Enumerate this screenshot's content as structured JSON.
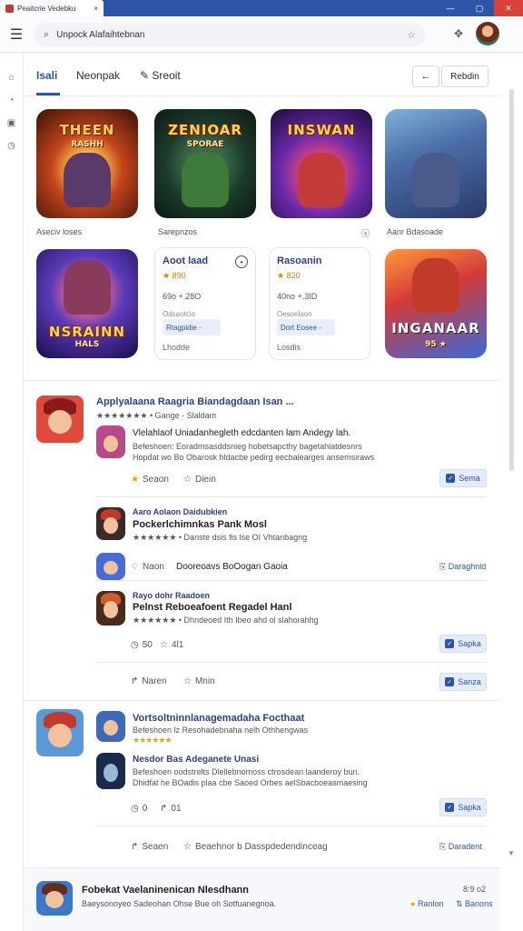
{
  "window": {
    "tab_title": "Peaitcrie Vedebku",
    "tab_close": "×",
    "controls": [
      "—",
      "▢",
      "✕"
    ]
  },
  "toolbar": {
    "search_value": "Unpock Alafaihtebnan",
    "menu_icon": "hamburger-icon",
    "bookmark_icon": "star-outline-icon",
    "gamepad_icon": "gamepad-icon"
  },
  "rail": {
    "icons": [
      "home-icon",
      "bell-icon",
      "library-icon",
      "history-icon"
    ]
  },
  "tabs": {
    "items": [
      "Isali",
      "Neonpak",
      "Sreoit"
    ],
    "back_label": "←",
    "review_label": "Rebdin"
  },
  "featured": {
    "tiles": [
      {
        "art_title": "THEEN",
        "art_sub": "RASHH",
        "caption": "Aseciv loses"
      },
      {
        "art_title": "ZENIOAR",
        "art_sub": "SPORAE",
        "caption": "Sarepnzos"
      },
      {
        "art_title": "INSWAN",
        "art_sub": "",
        "caption": ""
      },
      {
        "art_title": "",
        "art_sub": "",
        "caption": "Aanr Bdasoade",
        "caption_prefix": "ⓢ"
      }
    ],
    "row2": [
      {
        "art_title": "NSRAINN",
        "art_sub": "HALS",
        "caption": ""
      },
      {
        "title": "Aoot laad",
        "rating": "★ 890",
        "meta": "69o +.28O",
        "sub": "Odsaotcio",
        "chip": "Rtagpidie -",
        "foot": "Lhodde"
      },
      {
        "title": "Rasoanin",
        "rating": "★ 820",
        "meta": "40no +.3ID",
        "sub": "Oesoelaon",
        "chip": "Dort Eosee -",
        "foot": "Losdis"
      },
      {
        "art_title": "INGANAAR",
        "art_sub": "95 ★",
        "caption": ""
      }
    ]
  },
  "reviews": [
    {
      "title": "Applyalaana Raagria Biandagdaan Isan ...",
      "rating_line": "★★★★★★★ • Gange - Slaldam",
      "body_title": "Vlelahlaof Uniadanhegleth edcdanten lam Andegy lah.",
      "body_line1": "Befeshoen: Eoradmsasddsnieg hobetsapcthy bagetahlatdesnrs",
      "body_line2": "Hopdat wo Bo Obarosk hldacbe pedirg eecbalearges ansemsiraws",
      "actions": [
        "Seaon",
        "Diein"
      ],
      "button": "Sema"
    },
    {
      "title": "Aaro Aolaon Daidubkien",
      "title2": "Pockerlchimnkas Pank Mosl",
      "rating_line": "★★★★★★ • Danste dsis fis lse OI Vhtanbagng",
      "meta": "Dooreoavs BoOogan Gaoia",
      "meta_prefix": "Naon",
      "link": "Daraghnld"
    },
    {
      "title": "Rayo dohr Raadoen",
      "title2": "Pelnst Reboeafoent Regadel Hanl",
      "rating_line": "★★★★★★ • Dhndeoed Ith Ibeo ahd ol slahorahhg",
      "counts": [
        "50",
        "4l1"
      ],
      "button": "Sapka"
    },
    {
      "actions": [
        "Naren",
        "Mnin"
      ],
      "button": "Sanza"
    },
    {
      "title": "Vortsoltninnlanagemadaha Focthaat",
      "rating_line": "Befeshoen lz Resohadebnaha nelh Othhengwas",
      "sub_title": "Nesdor Bas Adeganete Unasi",
      "body_line1": "Befeshoen oodstrelts Dlellebnomoss ctrosdean laanderoy bun.",
      "body_line2": "Dhidfat he BOadis plaa cbe Saoed Orbes aelSbacboeasmaesing",
      "counts": [
        "0",
        "01"
      ],
      "button": "Sapka"
    },
    {
      "actions": [
        "Seaen",
        "Beaehnor b Dasspdedendinceag"
      ],
      "link": "Daradent"
    }
  ],
  "footer": {
    "title": "Fobekat Vaelaninenican Nlesdhann",
    "line": "Baeysonoyeo Sadeohan Ohse Bue oh Sotfuanegnoa.",
    "time": "8:9 o2",
    "right": "Ranlon",
    "right2": "Banons"
  },
  "colors": {
    "accent": "#2f55a8",
    "titlebar": "#2f55a8",
    "star": "#e8a400",
    "close_button": "#d9413a"
  }
}
